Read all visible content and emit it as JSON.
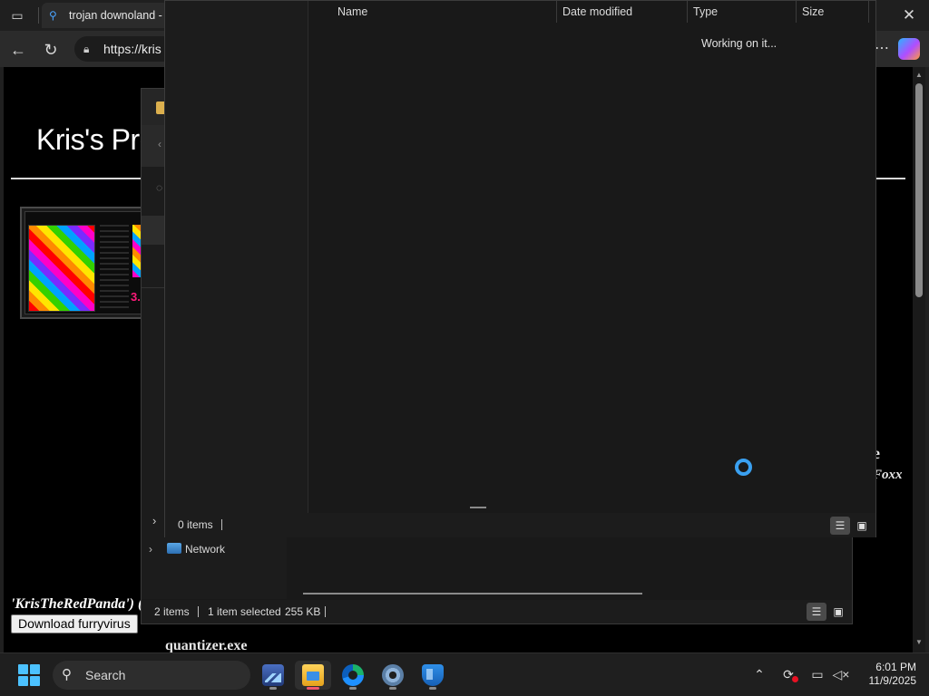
{
  "browser": {
    "tab_title": "trojan downoland -",
    "address": "https://kris"
  },
  "webpage": {
    "site_title": "Kris's Pro",
    "thumb_number": "3.",
    "right_fragment_1": "e",
    "right_fragment_2": "Foxx",
    "credit_line": "'KrisTheRedPanda') (",
    "download_button_label": "Download furryvirus",
    "bottom_filename": "quantizer.exe"
  },
  "explorer_back": {
    "nav": {
      "network_label": "Network"
    },
    "status": {
      "items": "2 items",
      "selected": "1 item selected",
      "size": "255 KB"
    }
  },
  "explorer_front": {
    "columns": {
      "name": "Name",
      "date_modified": "Date modified",
      "type": "Type",
      "size": "Size"
    },
    "working_text": "Working on it...",
    "status": {
      "items": "0 items"
    }
  },
  "taskbar": {
    "search_label": "Search",
    "apps": [
      "task-manager",
      "file-explorer",
      "edge",
      "settings",
      "defender"
    ],
    "clock_time": "6:01 PM",
    "clock_date": "11/9/2025"
  },
  "icons": {
    "start": "windows-logo-icon",
    "search": "magnifier-icon",
    "network": "network-icon",
    "spinner": "loading-spinner-icon"
  },
  "colors": {
    "accent": "#4cc2ff",
    "spinner": "#3aa0f0",
    "active_app_indicator": "#f0566b"
  }
}
